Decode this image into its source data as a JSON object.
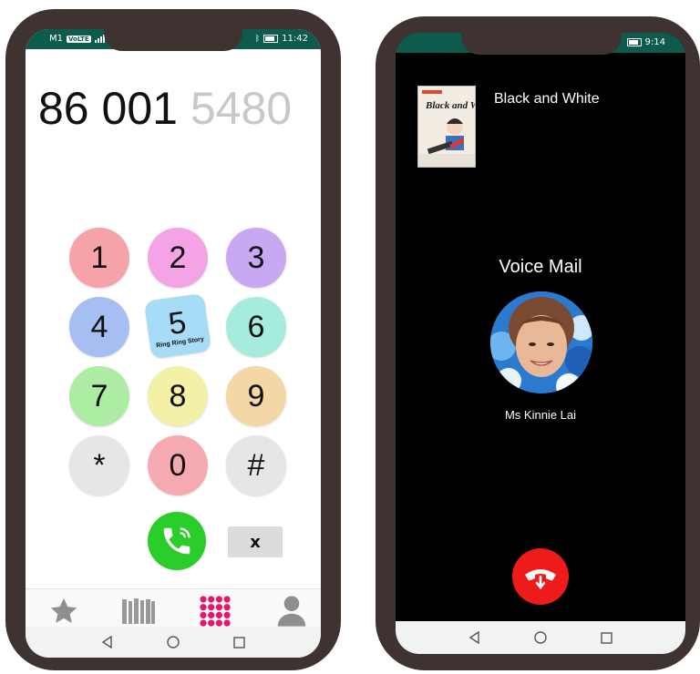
{
  "dialer": {
    "status": {
      "carrier": "M1",
      "network_badge": "VoLTE",
      "time": "11:42"
    },
    "number_entered": "86 001 ",
    "number_hint": "5480",
    "keys": [
      {
        "label": "1",
        "color": "#f5a3a8"
      },
      {
        "label": "2",
        "color": "#f3a3e6"
      },
      {
        "label": "3",
        "color": "#c9a8f3"
      },
      {
        "label": "4",
        "color": "#a7bef3"
      },
      {
        "label": "5",
        "color": "#a6dcf5",
        "sub": "Ring Ring Story"
      },
      {
        "label": "6",
        "color": "#a6ecdc"
      },
      {
        "label": "7",
        "color": "#aceca3"
      },
      {
        "label": "8",
        "color": "#f2f1a7"
      },
      {
        "label": "9",
        "color": "#f5d7a6"
      },
      {
        "label": "*",
        "color": "#e6e6e6"
      },
      {
        "label": "0",
        "color": "#f5a9b0"
      },
      {
        "label": "#",
        "color": "#e6e6e6"
      }
    ],
    "delete_label": "x",
    "tabs": [
      "star-icon",
      "bookshelf-icon",
      "keypad-icon",
      "person-icon"
    ],
    "accent_color": "#e8156a"
  },
  "call_screen": {
    "status": {
      "time": "9:14"
    },
    "book_title": "Black and White",
    "book_cover_text": "Black and White",
    "call_type": "Voice Mail",
    "caller_name": "Ms Kinnie Lai",
    "hangup_color": "#ee1b1b"
  }
}
